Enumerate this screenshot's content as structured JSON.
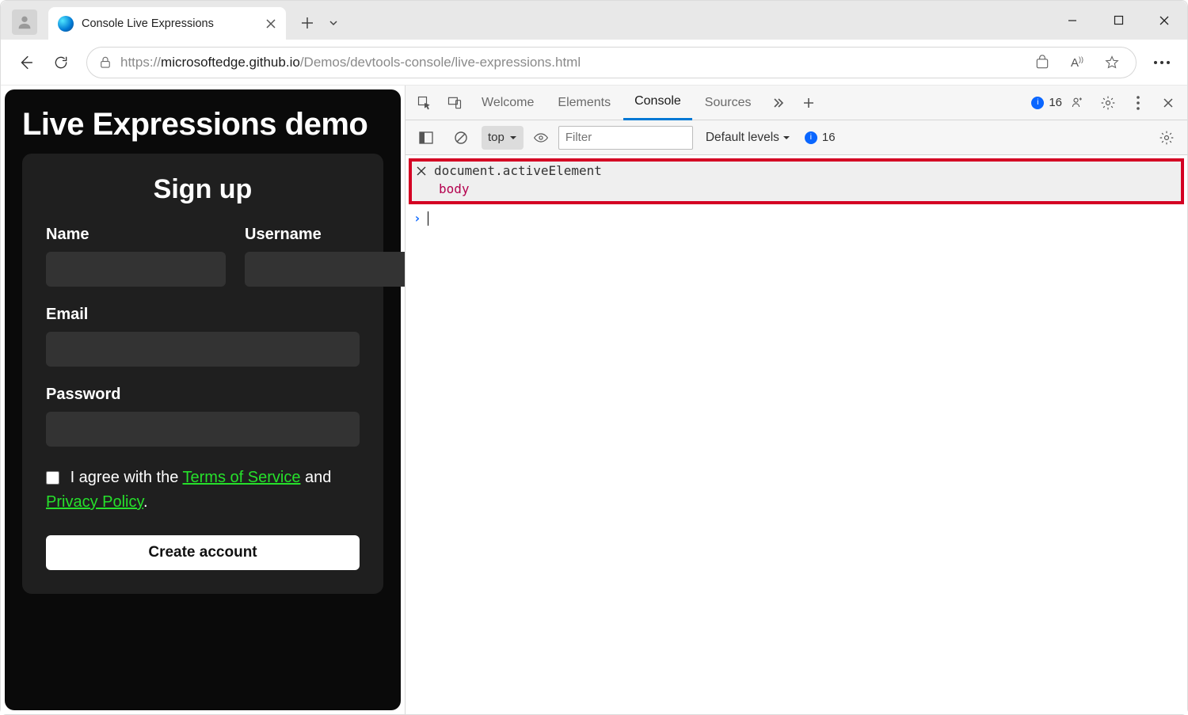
{
  "browser": {
    "tab_title": "Console Live Expressions",
    "url_prefix": "https://",
    "url_host": "microsoftedge.github.io",
    "url_path": "/Demos/devtools-console/live-expressions.html"
  },
  "page": {
    "title": "Live Expressions demo",
    "signup_heading": "Sign up",
    "labels": {
      "name": "Name",
      "username": "Username",
      "email": "Email",
      "password": "Password"
    },
    "terms_prefix": "I agree with the ",
    "terms_link": "Terms of Service",
    "terms_mid": " and ",
    "privacy_link": "Privacy Policy",
    "terms_suffix": ".",
    "create_button": "Create account"
  },
  "devtools": {
    "tabs": {
      "welcome": "Welcome",
      "elements": "Elements",
      "console": "Console",
      "sources": "Sources"
    },
    "msg_count": "16",
    "toolbar": {
      "context": "top",
      "filter_placeholder": "Filter",
      "levels": "Default levels",
      "hidden_count": "16"
    },
    "live_expression": {
      "expr": "document.activeElement",
      "result": "body"
    }
  }
}
